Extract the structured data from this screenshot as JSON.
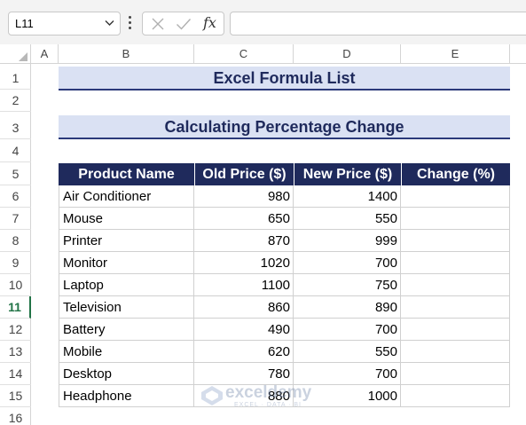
{
  "formula_bar": {
    "name_box": "L11",
    "formula": ""
  },
  "icons": {
    "dropdown": "chevron-down-icon",
    "more": "more-vertical-icon",
    "cancel": "cancel-x-icon",
    "enter": "checkmark-icon",
    "function": "fx-icon"
  },
  "fx_label": "fx",
  "columns": [
    "A",
    "B",
    "C",
    "D",
    "E"
  ],
  "rows": [
    "1",
    "2",
    "3",
    "4",
    "5",
    "6",
    "7",
    "8",
    "9",
    "10",
    "11",
    "12",
    "13",
    "14",
    "15",
    "16"
  ],
  "active_row": "11",
  "title": "Excel Formula List",
  "subtitle": "Calculating Percentage Change",
  "table": {
    "headers": [
      "Product Name",
      "Old Price ($)",
      "New Price ($)",
      "Change (%)"
    ],
    "rows": [
      {
        "product": "Air Conditioner",
        "old": "980",
        "new": "1400",
        "change": ""
      },
      {
        "product": "Mouse",
        "old": "650",
        "new": "550",
        "change": ""
      },
      {
        "product": "Printer",
        "old": "870",
        "new": "999",
        "change": ""
      },
      {
        "product": "Monitor",
        "old": "1020",
        "new": "700",
        "change": ""
      },
      {
        "product": "Laptop",
        "old": "1100",
        "new": "750",
        "change": ""
      },
      {
        "product": "Television",
        "old": "860",
        "new": "890",
        "change": ""
      },
      {
        "product": "Battery",
        "old": "490",
        "new": "700",
        "change": ""
      },
      {
        "product": "Mobile",
        "old": "620",
        "new": "550",
        "change": ""
      },
      {
        "product": "Desktop",
        "old": "780",
        "new": "700",
        "change": ""
      },
      {
        "product": "Headphone",
        "old": "880",
        "new": "1000",
        "change": ""
      }
    ]
  },
  "watermark": {
    "name": "exceldemy",
    "tagline": "EXCEL · DATA · BI"
  },
  "colors": {
    "header_fill": "#1f2a5c",
    "title_fill": "#dae1f3",
    "title_text": "#1f2a5c",
    "active_row": "#217346"
  }
}
